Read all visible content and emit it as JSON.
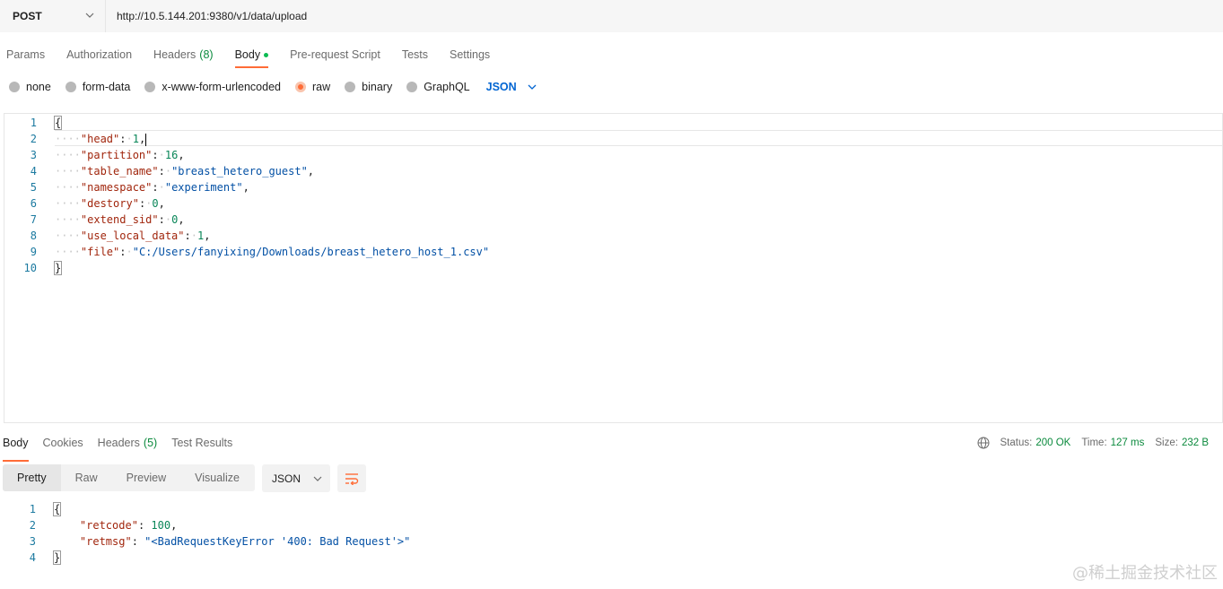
{
  "request": {
    "method": "POST",
    "url": "http://10.5.144.201:9380/v1/data/upload",
    "tabs": [
      {
        "label": "Params",
        "count": ""
      },
      {
        "label": "Authorization",
        "count": ""
      },
      {
        "label": "Headers",
        "count": "(8)"
      },
      {
        "label": "Body",
        "count": ""
      },
      {
        "label": "Pre-request Script",
        "count": ""
      },
      {
        "label": "Tests",
        "count": ""
      },
      {
        "label": "Settings",
        "count": ""
      }
    ],
    "active_tab": "Body",
    "body_types": [
      "none",
      "form-data",
      "x-www-form-urlencoded",
      "raw",
      "binary",
      "GraphQL"
    ],
    "selected_body_type": "raw",
    "language": "JSON",
    "body_lines": [
      {
        "n": "1",
        "text": "{"
      },
      {
        "n": "2",
        "text": "\"head\": 1,"
      },
      {
        "n": "3",
        "text": "\"partition\": 16,"
      },
      {
        "n": "4",
        "text": "\"table_name\": \"breast_hetero_guest\","
      },
      {
        "n": "5",
        "text": "\"namespace\": \"experiment\","
      },
      {
        "n": "6",
        "text": "\"destory\": 0,"
      },
      {
        "n": "7",
        "text": "\"extend_sid\": 0,"
      },
      {
        "n": "8",
        "text": "\"use_local_data\": 1,"
      },
      {
        "n": "9",
        "text": "\"file\": \"C:/Users/fanyixing/Downloads/breast_hetero_host_1.csv\""
      },
      {
        "n": "10",
        "text": "}"
      }
    ]
  },
  "response": {
    "tabs": [
      {
        "label": "Body",
        "count": ""
      },
      {
        "label": "Cookies",
        "count": ""
      },
      {
        "label": "Headers",
        "count": "(5)"
      },
      {
        "label": "Test Results",
        "count": ""
      }
    ],
    "status_label": "Status:",
    "status_value": "200 OK",
    "time_label": "Time:",
    "time_value": "127 ms",
    "size_label": "Size:",
    "size_value": "232 B",
    "view_modes": [
      "Pretty",
      "Raw",
      "Preview",
      "Visualize"
    ],
    "active_view": "Pretty",
    "format": "JSON",
    "body_lines": [
      {
        "n": "1",
        "text": "{"
      },
      {
        "n": "2",
        "text": "\"retcode\": 100,"
      },
      {
        "n": "3",
        "text": "\"retmsg\": \"<BadRequestKeyError '400: Bad Request'>\""
      },
      {
        "n": "4",
        "text": "}"
      }
    ]
  },
  "watermark": "@稀土掘金技术社区",
  "colors": {
    "accent": "#ff6c37",
    "status_green": "#0b8a3d",
    "link_blue": "#0265d2"
  },
  "icons": [
    "chevron-down-icon",
    "globe-icon",
    "wrap-lines-icon"
  ]
}
